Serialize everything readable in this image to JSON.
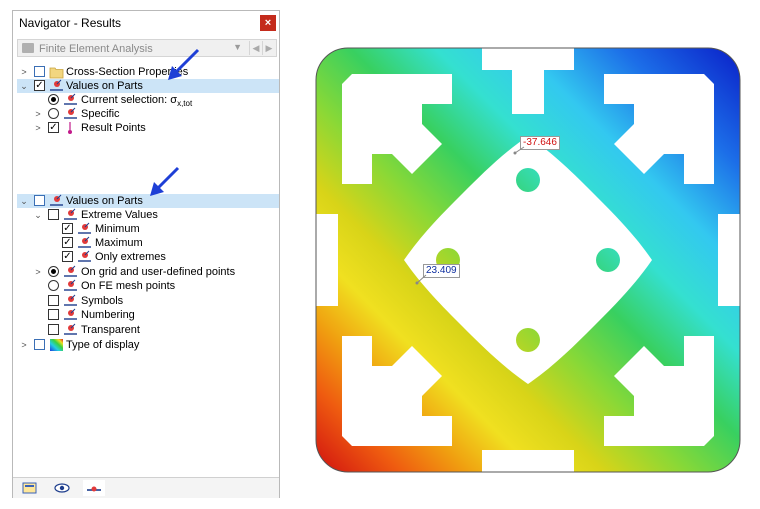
{
  "window": {
    "title": "Navigator - Results",
    "close_glyph": "×"
  },
  "dropdown": {
    "value": "Finite Element Analysis"
  },
  "tree_top": [
    {
      "label": "Cross-Section Properties"
    },
    {
      "label": "Values on Parts"
    },
    {
      "label": "Current selection: σ",
      "sub": "x,tot"
    },
    {
      "label": "Specific"
    },
    {
      "label": "Result Points"
    }
  ],
  "tree_bottom": [
    {
      "label": "Values on Parts"
    },
    {
      "label": "Extreme Values"
    },
    {
      "label": "Minimum"
    },
    {
      "label": "Maximum"
    },
    {
      "label": "Only extremes"
    },
    {
      "label": "On grid and user-defined points"
    },
    {
      "label": "On FE mesh points"
    },
    {
      "label": "Symbols"
    },
    {
      "label": "Numbering"
    },
    {
      "label": "Transparent"
    },
    {
      "label": "Type of display"
    }
  ],
  "figure": {
    "min_label": "-37.646",
    "max_label": "23.409"
  },
  "colors": {
    "selection": "#cce4f7",
    "arrow": "#1e3fd6",
    "min_label_text": "#d01010",
    "max_label_text": "#1030a0"
  },
  "icons": [
    "folder-icon",
    "values-on-parts-icon",
    "result-point-icon",
    "color-scale-icon",
    "eye-icon",
    "display-icon"
  ]
}
